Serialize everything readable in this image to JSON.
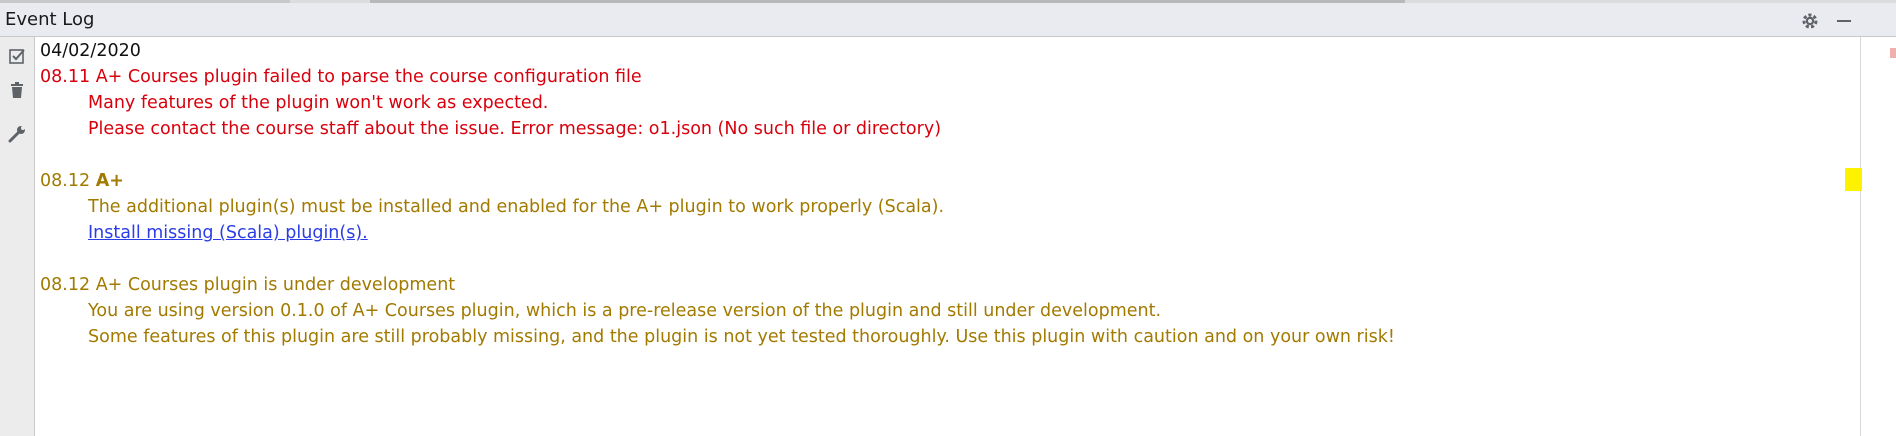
{
  "panel": {
    "title": "Event Log"
  },
  "colors": {
    "error": "#d8000c",
    "warning": "#a27a00",
    "link": "#2b3de6",
    "marker": "#fff200"
  },
  "toolbar": {
    "icons": [
      "mark-read-icon",
      "trash-icon",
      "wrench-icon"
    ]
  },
  "log": {
    "date": "04/02/2020",
    "events": [
      {
        "time": "08.11",
        "title": "A+ Courses plugin failed to parse the course configuration file",
        "lines": [
          "Many features of the plugin won't work as expected.",
          "Please contact the course staff about the issue. Error message: o1.json (No such file or directory)"
        ]
      },
      {
        "time": "08.12",
        "title": "A+",
        "lines": [
          "The additional plugin(s) must be installed and enabled for the A+ plugin to work properly (Scala)."
        ],
        "link": "Install missing (Scala) plugin(s)."
      },
      {
        "time": "08.12",
        "title": "A+ Courses plugin is under development",
        "lines": [
          "You are using version 0.1.0 of A+ Courses plugin, which is a pre-release version of the plugin and still under development.",
          "Some features of this plugin are still probably missing, and the plugin is not yet tested thoroughly. Use this plugin with caution and on your own risk!"
        ]
      }
    ]
  }
}
